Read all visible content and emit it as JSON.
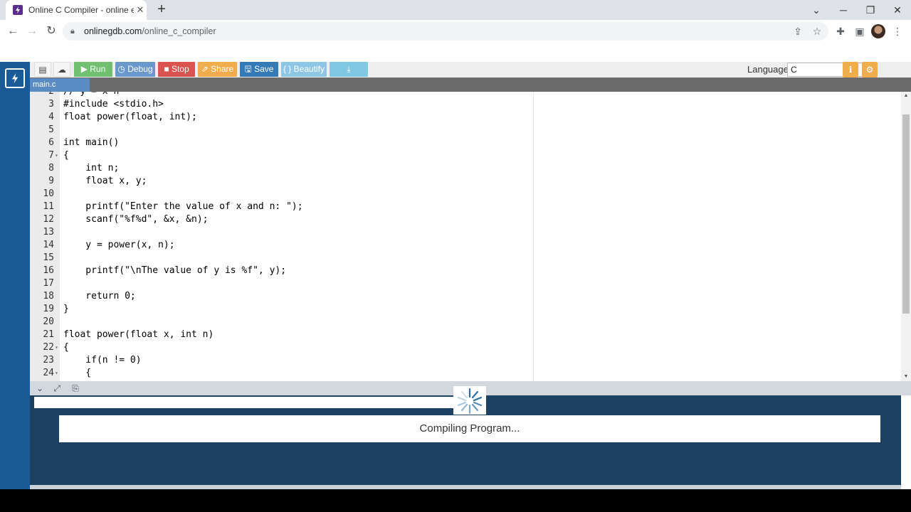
{
  "browser": {
    "tab_title": "Online C Compiler - online editor",
    "tab_close": "✕",
    "new_tab": "+",
    "window_controls": [
      "⌄",
      "─",
      "❐",
      "✕"
    ],
    "url_host": "onlinegdb.com",
    "url_path": "/online_c_compiler",
    "icons": [
      "back-arrow-icon",
      "forward-arrow-icon",
      "reload-icon",
      "lock-icon",
      "share-icon",
      "star-icon",
      "extensions-icon",
      "sidepanel-icon",
      "avatar",
      "menu-icon"
    ]
  },
  "toolbar": {
    "run": "Run",
    "debug": "Debug",
    "stop": "Stop",
    "share": "Share",
    "save": "Save",
    "beautify": "{ } Beautify",
    "language_label": "Language",
    "language_value": "C"
  },
  "file_tab": "main.c",
  "code_lines": [
    {
      "n": "2",
      "fold": "",
      "text": "// y = x^n"
    },
    {
      "n": "3",
      "fold": "",
      "text": "#include <stdio.h>"
    },
    {
      "n": "4",
      "fold": "",
      "text": "float power(float, int);"
    },
    {
      "n": "5",
      "fold": "",
      "text": ""
    },
    {
      "n": "6",
      "fold": "",
      "text": "int main()"
    },
    {
      "n": "7",
      "fold": "▾",
      "text": "{"
    },
    {
      "n": "8",
      "fold": "",
      "text": "    int n;"
    },
    {
      "n": "9",
      "fold": "",
      "text": "    float x, y;"
    },
    {
      "n": "10",
      "fold": "",
      "text": ""
    },
    {
      "n": "11",
      "fold": "",
      "text": "    printf(\"Enter the value of x and n: \");"
    },
    {
      "n": "12",
      "fold": "",
      "text": "    scanf(\"%f%d\", &x, &n);"
    },
    {
      "n": "13",
      "fold": "",
      "text": ""
    },
    {
      "n": "14",
      "fold": "",
      "text": "    y = power(x, n);"
    },
    {
      "n": "15",
      "fold": "",
      "text": ""
    },
    {
      "n": "16",
      "fold": "",
      "text": "    printf(\"\\nThe value of y is %f\", y);"
    },
    {
      "n": "17",
      "fold": "",
      "text": ""
    },
    {
      "n": "18",
      "fold": "",
      "text": "    return 0;"
    },
    {
      "n": "19",
      "fold": "",
      "text": "}"
    },
    {
      "n": "20",
      "fold": "",
      "text": ""
    },
    {
      "n": "21",
      "fold": "",
      "text": "float power(float x, int n)"
    },
    {
      "n": "22",
      "fold": "▾",
      "text": "{"
    },
    {
      "n": "23",
      "fold": "",
      "text": "    if(n != 0)"
    },
    {
      "n": "24",
      "fold": "▾",
      "text": "    {"
    }
  ],
  "console": {
    "status": "Compiling Program..."
  },
  "colors": {
    "sidebar": "#1a5a96",
    "console_bg": "#1d4160",
    "run": "#5cb85c",
    "stop": "#d9534f",
    "share": "#f0ad4e",
    "save": "#337ab7"
  }
}
